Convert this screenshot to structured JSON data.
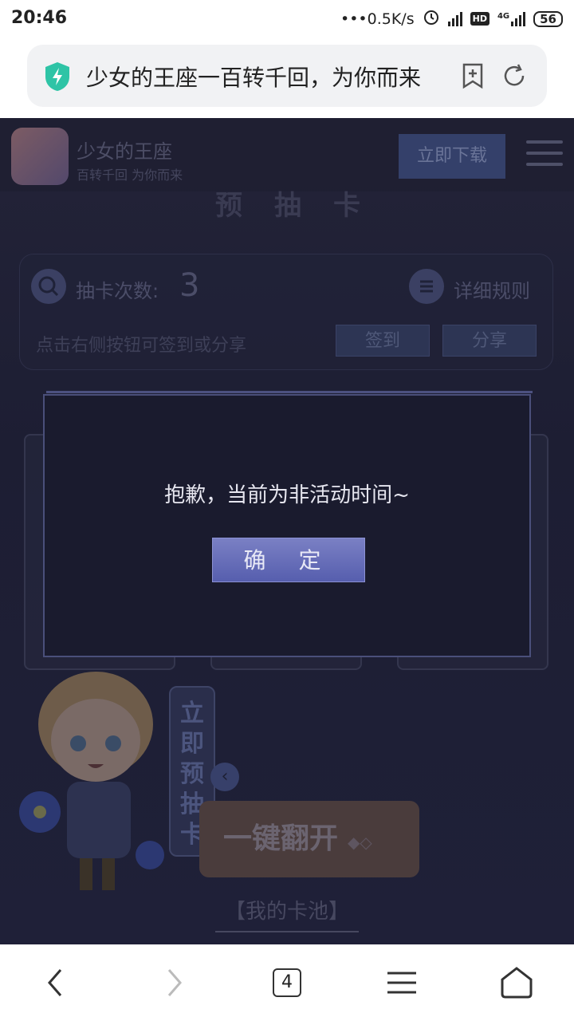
{
  "status": {
    "time": "20:46",
    "net_speed": "•••0.5K/s",
    "hd_badge": "HD",
    "network_type": "4G",
    "battery": "56",
    "icons": [
      "alarm-icon",
      "signal-icon",
      "hd-icon",
      "signal-4g-icon",
      "battery-icon"
    ]
  },
  "browser": {
    "page_title": "少女的王座一百转千回，为你而来",
    "tab_count": "4",
    "icons": [
      "shield-icon",
      "add-bookmark-icon",
      "refresh-icon",
      "back-icon",
      "forward-icon",
      "menu-icon",
      "home-icon"
    ]
  },
  "app_banner": {
    "name": "少女的王座",
    "subtitle": "百转千回 为你而来",
    "download_label": "立即下载"
  },
  "background_page": {
    "peek_title": "预抽卡",
    "draw_label": "抽卡次数:",
    "draw_count": "3",
    "rules_label": "详细规则",
    "hint": "点击右侧按钮可签到或分享",
    "checkin_label": "签到",
    "share_label": "分享",
    "vertical_tab": "立即预抽卡",
    "flip_all_label": "一键翻开",
    "my_pool_label": "【我的卡池】"
  },
  "modal": {
    "message": "抱歉，当前为非活动时间~",
    "confirm_label": "确 定"
  },
  "colors": {
    "modal_bg": "#1a1b2e",
    "confirm_button": "#5e66b5",
    "page_overlay": "#1d1e33"
  }
}
